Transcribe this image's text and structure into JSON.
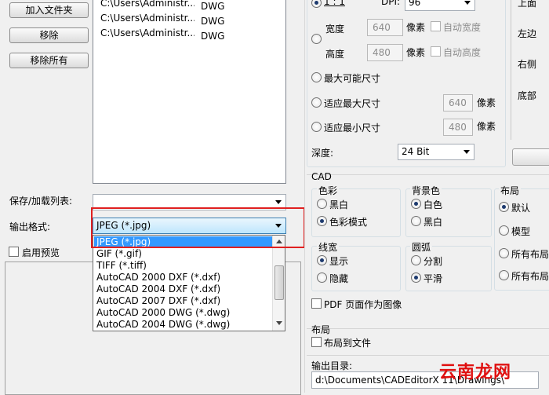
{
  "left": {
    "buttons": {
      "add_files": "加入文件夹",
      "remove": "移除",
      "remove_all": "移除所有"
    },
    "files": [
      {
        "path": "C:\\Users\\Administr...",
        "type": "DWG"
      },
      {
        "path": "C:\\Users\\Administr...",
        "type": "DWG"
      },
      {
        "path": "C:\\Users\\Administr...",
        "type": "DWG"
      }
    ],
    "save_load_label": "保存/加载列表:",
    "output_format_label": "输出格式:",
    "output_format_value": "JPEG (*.jpg)",
    "enable_preview_label": "启用预览",
    "format_options": [
      "JPEG (*.jpg)",
      "GIF (*.gif)",
      "TIFF (*.tiff)",
      "AutoCAD 2000 DXF (*.dxf)",
      "AutoCAD 2004 DXF (*.dxf)",
      "AutoCAD 2007 DXF (*.dxf)",
      "AutoCAD 2000 DWG (*.dwg)",
      "AutoCAD 2004 DWG (*.dwg)"
    ]
  },
  "size": {
    "ratio_label": "1 : 1",
    "dpi_label": "DPI:",
    "dpi_value": "96",
    "width_label": "宽度",
    "width_value": "640",
    "height_label": "高度",
    "height_value": "480",
    "pixels_label": "像素",
    "auto_width": "自动宽度",
    "auto_height": "自动高度",
    "max_size": "最大可能尺寸",
    "fit_max": "适应最大尺寸",
    "fit_min": "适应最小尺寸",
    "fit_max_value": "640",
    "fit_min_value": "480",
    "depth_label": "深度:",
    "depth_value": "24 Bit"
  },
  "margins": {
    "top": "上面",
    "left": "左边",
    "right": "右侧",
    "bottom": "底部"
  },
  "cad": {
    "title": "CAD",
    "color_title": "色彩",
    "color_bw": "黑白",
    "color_mode": "色彩模式",
    "bg_title": "背景色",
    "bg_white": "白色",
    "bg_black": "黑白",
    "layout_title": "布局",
    "layout_default": "默认",
    "layout_model": "模型",
    "layout_all1": "所有布局",
    "layout_all2": "所有布局",
    "lineweight_title": "线宽",
    "lw_show": "显示",
    "lw_hide": "隐藏",
    "arc_title": "圆弧",
    "arc_split": "分割",
    "arc_smooth": "平滑",
    "pdf_as_image": "PDF 页面作为图像"
  },
  "layout_section": {
    "title": "布局",
    "layout_to_file": "布局到文件"
  },
  "output_dir": {
    "label": "输出目录:",
    "value": "d:\\Documents\\CADEditorX 11\\Drawings\\"
  },
  "watermark": "云南龙网"
}
